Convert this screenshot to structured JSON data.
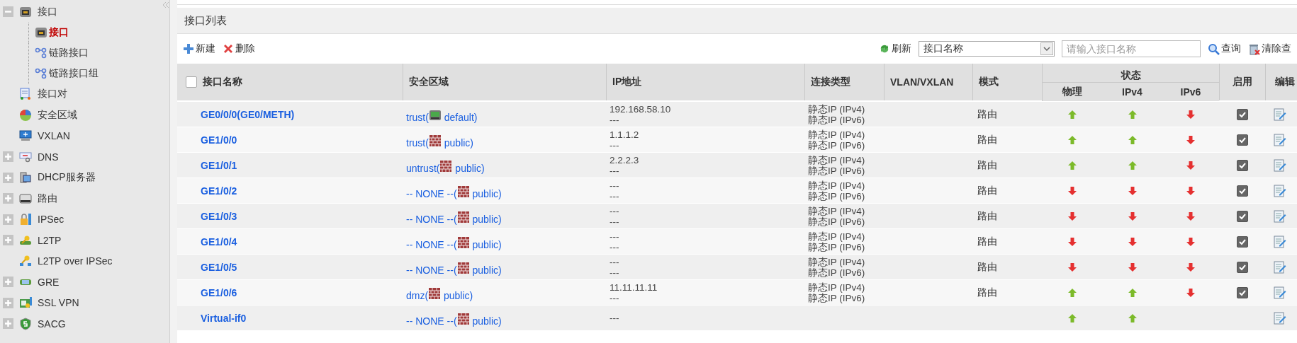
{
  "sidebar": {
    "items": [
      {
        "label": "接口",
        "expanded": true,
        "selected": false,
        "children": [
          {
            "label": "接口",
            "selected": true
          },
          {
            "label": "链路接口",
            "selected": false
          },
          {
            "label": "链路接口组",
            "selected": false
          }
        ]
      },
      {
        "label": "接口对",
        "selected": false
      },
      {
        "label": "安全区域",
        "selected": false
      },
      {
        "label": "VXLAN",
        "selected": false
      },
      {
        "label": "DNS",
        "expanded": false,
        "selected": false
      },
      {
        "label": "DHCP服务器",
        "expanded": false,
        "selected": false
      },
      {
        "label": "路由",
        "expanded": false,
        "selected": false
      },
      {
        "label": "IPSec",
        "expanded": false,
        "selected": false
      },
      {
        "label": "L2TP",
        "expanded": false,
        "selected": false
      },
      {
        "label": "L2TP over IPSec",
        "selected": false
      },
      {
        "label": "GRE",
        "expanded": false,
        "selected": false
      },
      {
        "label": "SSL VPN",
        "expanded": false,
        "selected": false
      },
      {
        "label": "SACG",
        "expanded": false,
        "selected": false
      }
    ]
  },
  "panel": {
    "title": "接口列表",
    "toolbar": {
      "new": "新建",
      "delete": "删除",
      "refresh": "刷新",
      "filter_field": "接口名称",
      "search": {
        "placeholder": "请输入接口名称"
      },
      "query": "查询",
      "clear": "清除查"
    },
    "table": {
      "select_all": {
        "checked": false
      },
      "columns": [
        "接口名称",
        "安全区域",
        "IP地址",
        "连接类型",
        "VLAN/VXLAN",
        "模式"
      ],
      "status_group": "状态",
      "status_columns": [
        "物理",
        "IPv4",
        "IPv6"
      ],
      "tail_columns": [
        "启用",
        "编辑"
      ],
      "rows": [
        {
          "name": "GE0/0/0(GE0/METH)",
          "zone": {
            "kind": "root",
            "before": "trust(",
            "after": "default)"
          },
          "ip": [
            "192.168.58.10",
            "---"
          ],
          "conn": [
            "静态IP (IPv4)",
            "静态IP (IPv6)"
          ],
          "mode": "路由",
          "phys_up": true,
          "ipv4_up": true,
          "ipv6_up": false,
          "enabled": true
        },
        {
          "name": "GE1/0/0",
          "zone": {
            "kind": "vsys",
            "before": "trust(",
            "after": "public)"
          },
          "ip": [
            "1.1.1.2",
            "---"
          ],
          "conn": [
            "静态IP (IPv4)",
            "静态IP (IPv6)"
          ],
          "mode": "路由",
          "phys_up": true,
          "ipv4_up": true,
          "ipv6_up": false,
          "enabled": true
        },
        {
          "name": "GE1/0/1",
          "zone": {
            "kind": "vsys",
            "before": "untrust(",
            "after": "public)"
          },
          "ip": [
            "2.2.2.3",
            "---"
          ],
          "conn": [
            "静态IP (IPv4)",
            "静态IP (IPv6)"
          ],
          "mode": "路由",
          "phys_up": true,
          "ipv4_up": true,
          "ipv6_up": false,
          "enabled": true
        },
        {
          "name": "GE1/0/2",
          "zone": {
            "kind": "vsys",
            "before": "-- NONE --(",
            "after": "public)"
          },
          "ip": [
            "---",
            "---"
          ],
          "conn": [
            "静态IP (IPv4)",
            "静态IP (IPv6)"
          ],
          "mode": "路由",
          "phys_up": false,
          "ipv4_up": false,
          "ipv6_up": false,
          "enabled": true
        },
        {
          "name": "GE1/0/3",
          "zone": {
            "kind": "vsys",
            "before": "-- NONE --(",
            "after": "public)"
          },
          "ip": [
            "---",
            "---"
          ],
          "conn": [
            "静态IP (IPv4)",
            "静态IP (IPv6)"
          ],
          "mode": "路由",
          "phys_up": false,
          "ipv4_up": false,
          "ipv6_up": false,
          "enabled": true
        },
        {
          "name": "GE1/0/4",
          "zone": {
            "kind": "vsys",
            "before": "-- NONE --(",
            "after": "public)"
          },
          "ip": [
            "---",
            "---"
          ],
          "conn": [
            "静态IP (IPv4)",
            "静态IP (IPv6)"
          ],
          "mode": "路由",
          "phys_up": false,
          "ipv4_up": false,
          "ipv6_up": false,
          "enabled": true
        },
        {
          "name": "GE1/0/5",
          "zone": {
            "kind": "vsys",
            "before": "-- NONE --(",
            "after": "public)"
          },
          "ip": [
            "---",
            "---"
          ],
          "conn": [
            "静态IP (IPv4)",
            "静态IP (IPv6)"
          ],
          "mode": "路由",
          "phys_up": false,
          "ipv4_up": false,
          "ipv6_up": false,
          "enabled": true
        },
        {
          "name": "GE1/0/6",
          "zone": {
            "kind": "vsys",
            "before": "dmz(",
            "after": "public)"
          },
          "ip": [
            "11.11.11.11",
            "---"
          ],
          "conn": [
            "静态IP (IPv4)",
            "静态IP (IPv6)"
          ],
          "mode": "路由",
          "phys_up": true,
          "ipv4_up": true,
          "ipv6_up": false,
          "enabled": true
        },
        {
          "name": "Virtual-if0",
          "zone": {
            "kind": "vsys",
            "before": "-- NONE --(",
            "after": "public)"
          },
          "ip": [
            "---"
          ],
          "phys_up": true,
          "ipv4_up": true
        }
      ]
    }
  }
}
